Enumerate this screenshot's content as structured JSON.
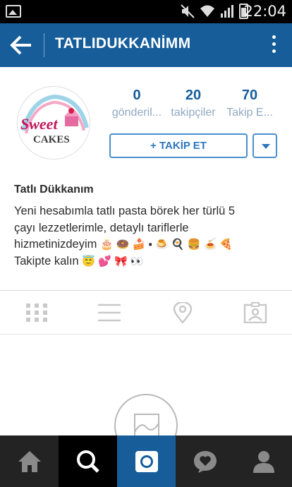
{
  "status_bar": {
    "time": "22:04"
  },
  "app_bar": {
    "title": "TATLIDUKKANİMM"
  },
  "profile": {
    "picture_text_top": "Sweet",
    "picture_text_bottom": "CAKES",
    "stats": [
      {
        "value": "0",
        "label": "gönderil..."
      },
      {
        "value": "20",
        "label": "takipçiler"
      },
      {
        "value": "70",
        "label": "Takip E..."
      }
    ],
    "follow_button_label": "+ TAKİP ET",
    "full_name": "Tatlı Dükkanım",
    "bio_line_1": "Yeni hesabımla tatlı pasta börek her türlü 5",
    "bio_line_2": "çayı lezzetlerimle, detaylı tariflerle",
    "bio_line_3": "hizmetinizdeyim",
    "bio_line_3_emoji": "🎂 🍩 🍰 ▪ 🍮 🍳 🍔 🍝 🍕",
    "bio_line_4": "Takipte kalın",
    "bio_line_4_emoji": "😇 💕 🎀 👀"
  },
  "tabs": [
    "grid-view",
    "list-view",
    "map-view",
    "tagged-view"
  ],
  "bottom_nav": [
    "home",
    "search",
    "camera",
    "activity",
    "profile"
  ],
  "colors": {
    "brand_blue": "#165d9a",
    "link_blue": "#2e77bd",
    "stat_label": "#8fa9c3",
    "nav_bg": "#232323"
  }
}
